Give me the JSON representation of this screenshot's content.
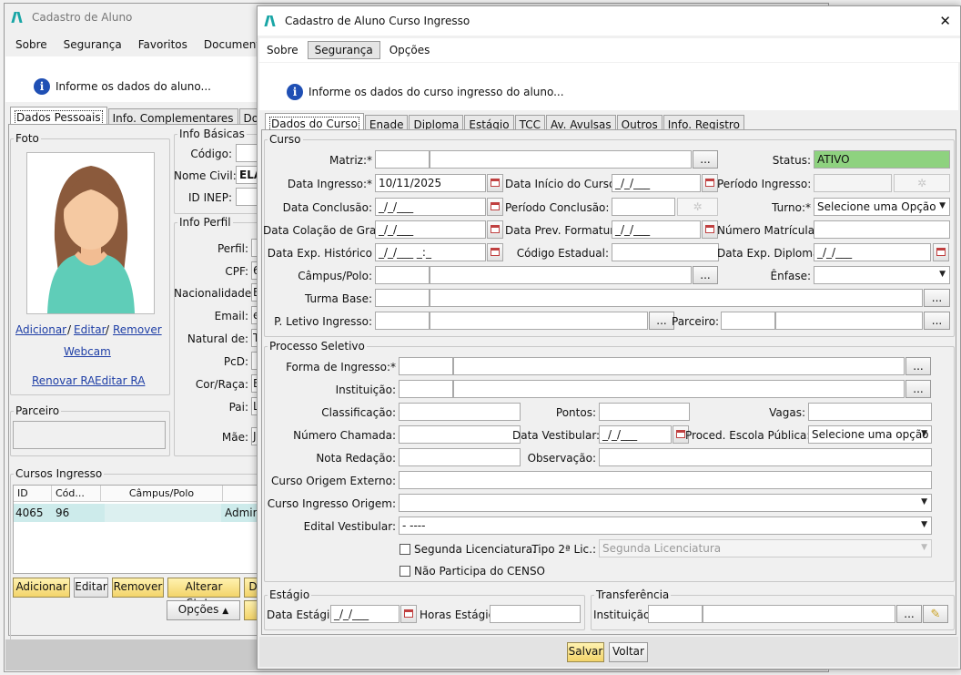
{
  "back": {
    "title": "Cadastro de Aluno",
    "menu": [
      "Sobre",
      "Segurança",
      "Favoritos",
      "Documentos"
    ],
    "info": "Informe os dados do aluno...",
    "tabs": [
      "Dados Pessoais",
      "Info. Complementares",
      "Docume"
    ],
    "foto": {
      "title": "Foto",
      "adicionar": "Adicionar",
      "sep1": "/",
      "editar": "Editar",
      "sep2": "/",
      "remover": "Remover",
      "webcam": "Webcam",
      "renovar_ra": "Renovar RA",
      "editar_ra": "Editar RA"
    },
    "info_basicas": {
      "title": "Info Básicas",
      "codigo": "Código:",
      "nome_civil": "Nome Civil:",
      "nome_value": "ELA",
      "id_inep": "ID INEP:"
    },
    "info_perfil": {
      "title": "Info Perfil",
      "fields": [
        "Perfil:",
        "CPF:",
        "Nacionalidade:",
        "Email:",
        "Natural de:",
        "PcD:",
        "Cor/Raça:",
        "Pai:",
        "Mãe:"
      ],
      "values": [
        "",
        "6",
        "E",
        "e",
        "T",
        "",
        "E",
        "L",
        "J"
      ]
    },
    "parceiro": {
      "title": "Parceiro"
    },
    "cursos": {
      "title": "Cursos Ingresso",
      "columns": [
        "ID",
        "Cód...",
        "Câmpus/Polo",
        ""
      ],
      "row": [
        "4065",
        "96",
        "",
        "Admin"
      ]
    },
    "buttons": {
      "adicionar": "Adicionar",
      "editar": "Editar",
      "remover": "Remover",
      "alterar_status": "Alterar Status",
      "d": "D",
      "opcoes": "Opções"
    }
  },
  "dialog": {
    "title": "Cadastro de Aluno Curso Ingresso",
    "close": "✕",
    "menu": [
      "Sobre",
      "Segurança",
      "Opções"
    ],
    "info": "Informe os dados do curso ingresso do aluno...",
    "tabs": [
      "Dados do Curso",
      "Enade",
      "Diploma",
      "Estágio",
      "TCC",
      "Av. Avulsas",
      "Outros",
      "Info. Registro"
    ],
    "curso": {
      "title": "Curso",
      "matriz": "Matriz:*",
      "status": "Status:",
      "status_value": "ATIVO",
      "data_ingresso": "Data Ingresso:*",
      "data_ingresso_value": "10/11/2025",
      "data_inicio": "Data Início do Curso:",
      "data_inicio_value": "_/_/___",
      "periodo_ingresso": "Período Ingresso:",
      "data_conclusao": "Data Conclusão:",
      "data_conclusao_value": "_/_/___",
      "periodo_conclusao": "Período Conclusão:",
      "turno": "Turno:*",
      "turno_value": "Selecione uma Opção",
      "data_colacao": "Data Colação de Grau:",
      "data_colacao_value": "_/_/___",
      "data_prev": "Data Prev. Formatura:",
      "data_prev_value": "_/_/___",
      "numero_matricula": "Número Matrícula:",
      "data_exp_hist": "Data Exp. Histórico",
      "data_exp_hist_value": "_/_/___ _:_",
      "codigo_estadual": "Código Estadual:",
      "data_exp_diploma": "Data Exp. Diploma:",
      "data_exp_diploma_value": "_/_/___",
      "campus": "Câmpus/Polo:",
      "enfase": "Ênfase:",
      "turma_base": "Turma Base:",
      "p_letivo": "P. Letivo Ingresso:",
      "parceiro": "Parceiro:"
    },
    "processo": {
      "title": "Processo Seletivo",
      "forma_ingresso": "Forma de Ingresso:*",
      "instituicao": "Instituição:",
      "classificacao": "Classificação:",
      "pontos": "Pontos:",
      "vagas": "Vagas:",
      "numero_chamada": "Número Chamada:",
      "data_vestibular": "Data Vestibular:",
      "data_vestibular_value": "_/_/___",
      "proced_escola": "Proced. Escola Pública:*",
      "proced_value": "Selecione uma opção",
      "nota_redacao": "Nota Redação:",
      "observacao": "Observação:",
      "curso_origem_externo": "Curso Origem Externo:",
      "curso_ingresso_origem": "Curso Ingresso Origem:",
      "edital": "Edital Vestibular:",
      "edital_value": "- ----",
      "segunda_lic": "Segunda Licenciatura.",
      "tipo_2_lic": "Tipo 2ª Lic.:",
      "tipo_2_lic_value": "Segunda Licenciatura",
      "nao_participa": "Não Participa do CENSO"
    },
    "estagio": {
      "title": "Estágio",
      "data": "Data Estágio:",
      "data_value": "_/_/___",
      "horas": "Horas Estágio:"
    },
    "transferencia": {
      "title": "Transferência",
      "instituicao": "Instituição:"
    },
    "buttons": {
      "salvar": "Salvar",
      "voltar": "Voltar",
      "dots": "..."
    }
  },
  "colors": {
    "accent": "#1f4fb4",
    "status_green": "#8ed27f",
    "button_yellow": "#f3d46a",
    "row_selected": "#cdebeb"
  }
}
